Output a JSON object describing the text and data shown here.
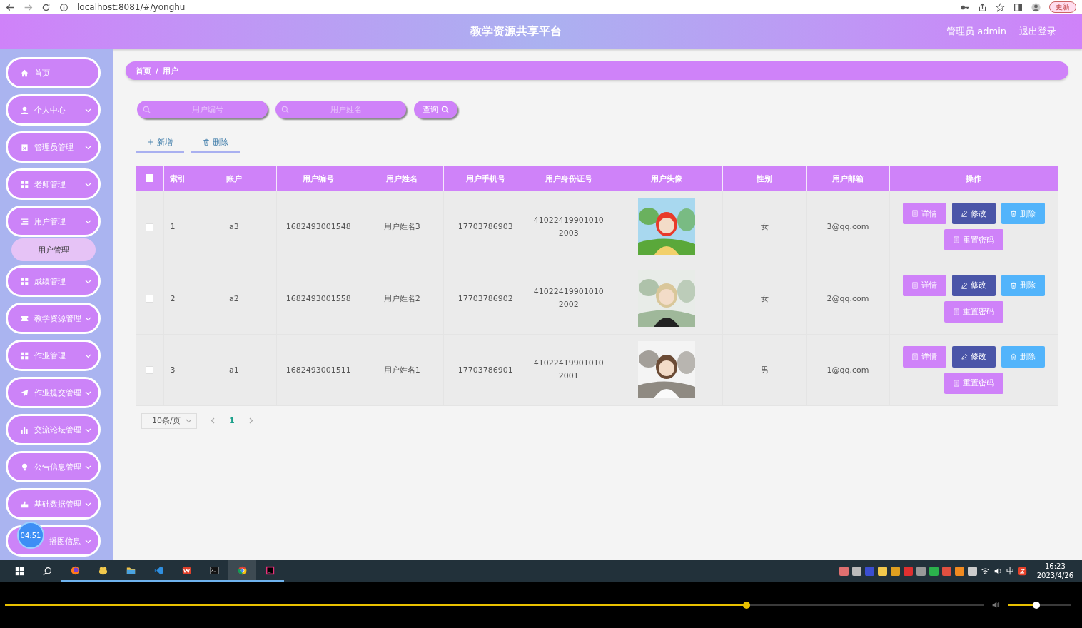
{
  "browser": {
    "url": "localhost:8081/#/yonghu",
    "update_button": "更新"
  },
  "header": {
    "title": "教学资源共享平台",
    "user": "管理员 admin",
    "logout": "退出登录"
  },
  "sidebar": {
    "items": [
      {
        "label": "首页",
        "expandable": false
      },
      {
        "label": "个人中心",
        "expandable": true,
        "expanded": false
      },
      {
        "label": "管理员管理",
        "expandable": true,
        "expanded": false
      },
      {
        "label": "老师管理",
        "expandable": true,
        "expanded": false
      },
      {
        "label": "用户管理",
        "expandable": true,
        "expanded": true,
        "children": [
          {
            "label": "用户管理",
            "selected": true
          }
        ]
      },
      {
        "label": "成绩管理",
        "expandable": true,
        "expanded": false
      },
      {
        "label": "教学资源管理",
        "expandable": true,
        "expanded": false
      },
      {
        "label": "作业管理",
        "expandable": true,
        "expanded": false
      },
      {
        "label": "作业提交管理",
        "expandable": true,
        "expanded": false
      },
      {
        "label": "交流论坛管理",
        "expandable": true,
        "expanded": false
      },
      {
        "label": "公告信息管理",
        "expandable": true,
        "expanded": false
      },
      {
        "label": "基础数据管理",
        "expandable": true,
        "expanded": false
      },
      {
        "label": "播图信息",
        "expandable": true,
        "expanded": false
      }
    ]
  },
  "timer_bubble": "04:51",
  "breadcrumb": {
    "items": [
      "首页",
      "用户"
    ],
    "separator": "/"
  },
  "search": {
    "fields": [
      {
        "placeholder": "用户编号"
      },
      {
        "placeholder": "用户姓名"
      }
    ],
    "button": "查询"
  },
  "actions": [
    {
      "label": "新增",
      "kind": "add"
    },
    {
      "label": "删除",
      "kind": "delete"
    }
  ],
  "table": {
    "select_all": false,
    "columns": [
      "索引",
      "账户",
      "用户编号",
      "用户姓名",
      "用户手机号",
      "用户身份证号",
      "用户头像",
      "性别",
      "用户邮箱",
      "操作"
    ],
    "rows": [
      {
        "checked": false,
        "index": "1",
        "account": "a3",
        "number": "1682493001548",
        "name": "用户姓名3",
        "phone": "17703786903",
        "id_card": "410224199010102003",
        "gender": "女",
        "email": "3@qq.com",
        "buttons": [
          {
            "label": "详情",
            "kind": "detail"
          },
          {
            "label": "修改",
            "kind": "edit"
          },
          {
            "label": "删除",
            "kind": "delete"
          },
          {
            "label": "重置密码",
            "kind": "reset"
          }
        ]
      },
      {
        "checked": false,
        "index": "2",
        "account": "a2",
        "number": "1682493001558",
        "name": "用户姓名2",
        "phone": "17703786902",
        "id_card": "410224199010102002",
        "gender": "女",
        "email": "2@qq.com",
        "buttons": [
          {
            "label": "详情",
            "kind": "detail"
          },
          {
            "label": "修改",
            "kind": "edit"
          },
          {
            "label": "删除",
            "kind": "delete"
          },
          {
            "label": "重置密码",
            "kind": "reset"
          }
        ]
      },
      {
        "checked": false,
        "index": "3",
        "account": "a1",
        "number": "1682493001511",
        "name": "用户姓名1",
        "phone": "17703786901",
        "id_card": "410224199010102001",
        "gender": "男",
        "email": "1@qq.com",
        "buttons": [
          {
            "label": "详情",
            "kind": "detail"
          },
          {
            "label": "修改",
            "kind": "edit"
          },
          {
            "label": "删除",
            "kind": "delete"
          },
          {
            "label": "重置密码",
            "kind": "reset"
          }
        ]
      }
    ]
  },
  "pagination": {
    "page_size": "10条/页",
    "pages": [
      {
        "label": "1",
        "selected": true
      }
    ]
  },
  "taskbar": {
    "apps": [
      {
        "selected": false
      },
      {
        "selected": false
      },
      {
        "selected": false
      },
      {
        "selected": false
      },
      {
        "selected": false
      },
      {
        "selected": false
      },
      {
        "selected": true
      },
      {
        "selected": false
      }
    ],
    "ime": "中",
    "time": "16:23",
    "date": "2023/4/26"
  },
  "player": {
    "progress": {
      "level": 0.757
    },
    "volume": {
      "level": 0.45
    }
  }
}
